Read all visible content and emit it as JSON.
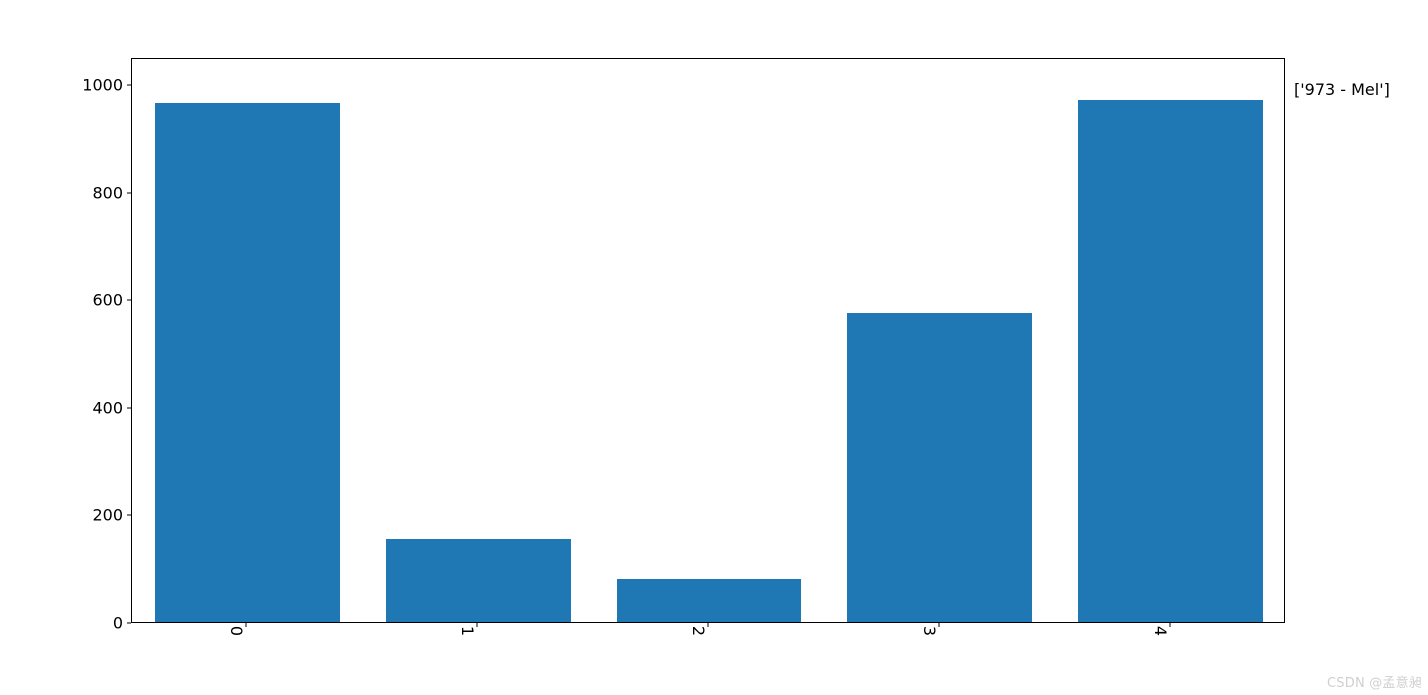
{
  "chart_data": {
    "type": "bar",
    "categories": [
      "0",
      "1",
      "2",
      "3",
      "4"
    ],
    "values": [
      965,
      155,
      80,
      575,
      970
    ],
    "title": "['973 - Mel']",
    "xlabel": "",
    "ylabel": "",
    "ylim": [
      0,
      1050
    ],
    "yticks": [
      0,
      200,
      400,
      600,
      800,
      1000
    ],
    "bar_color": "#1f77b4"
  },
  "side_label": "['973 - Mel']",
  "watermark": "CSDN @孟意昶"
}
